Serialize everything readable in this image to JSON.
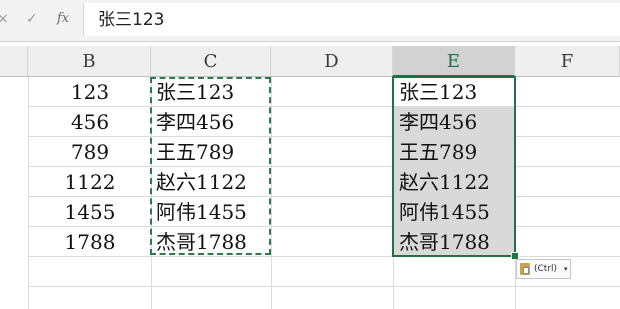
{
  "formula_bar": {
    "cancel_icon": "×",
    "enter_icon": "✓",
    "fx_icon": "fx",
    "value": "张三123"
  },
  "columns": [
    "B",
    "C",
    "D",
    "E",
    "F"
  ],
  "selected_column": "E",
  "column_b": [
    "123",
    "456",
    "789",
    "1122",
    "1455",
    "1788"
  ],
  "column_c": [
    "张三123",
    "李四456",
    "王五789",
    "赵六1122",
    "阿伟1455",
    "杰哥1788"
  ],
  "column_e": [
    "张三123",
    "李四456",
    "王五789",
    "赵六1122",
    "阿伟1455",
    "杰哥1788"
  ],
  "paste_options": {
    "label": "(Ctrl)",
    "caret": "▾"
  },
  "colors": {
    "selection": "#217346",
    "marquee": "#2f7a4a",
    "shaded": "#d9d9d9"
  }
}
